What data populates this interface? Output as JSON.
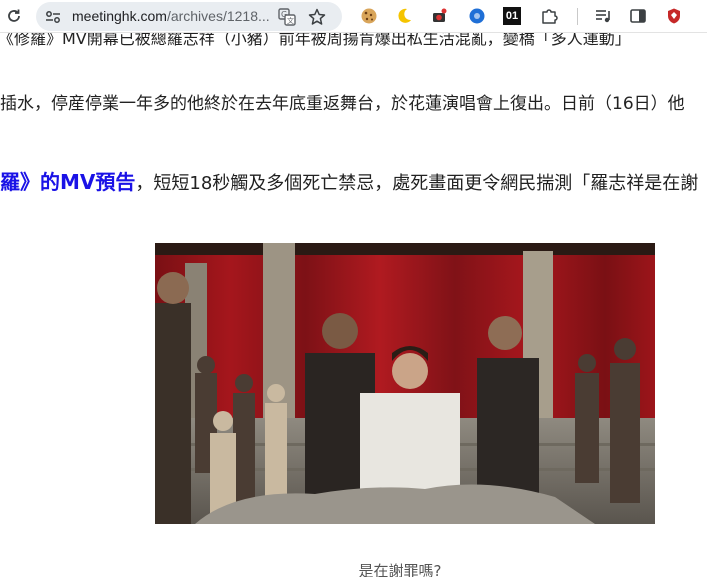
{
  "browser": {
    "url_domain": "meetinghk.com",
    "url_path": "/archives/1218...",
    "extensions": [
      "cookie-icon",
      "moon-icon",
      "camera-icon",
      "globe-icon",
      "01-icon",
      "puzzle-icon",
      "media-icon",
      "sidepanel-icon",
      "shield-icon"
    ],
    "ext_01_label": "01"
  },
  "article": {
    "line1": "《修羅》MV開幕已被總羅志祥（小豬）前年被周揚肯爆出私生活混亂，變橋「多人運動」",
    "line2": "插水，停産停業一年多的他終於在去年底重返舞台，於花蓮演唱會上復出。日前（16日）他",
    "line3_link": "羅》的MV預告",
    "line3_rest": "，短短18秒觸及多個死亡禁忌，處死畫面更令網民揣測「羅志祥是在謝",
    "caption": "是在謝罪嗎?"
  },
  "colors": {
    "link": "#1a12e6",
    "omnibox": "#e9edf1"
  }
}
